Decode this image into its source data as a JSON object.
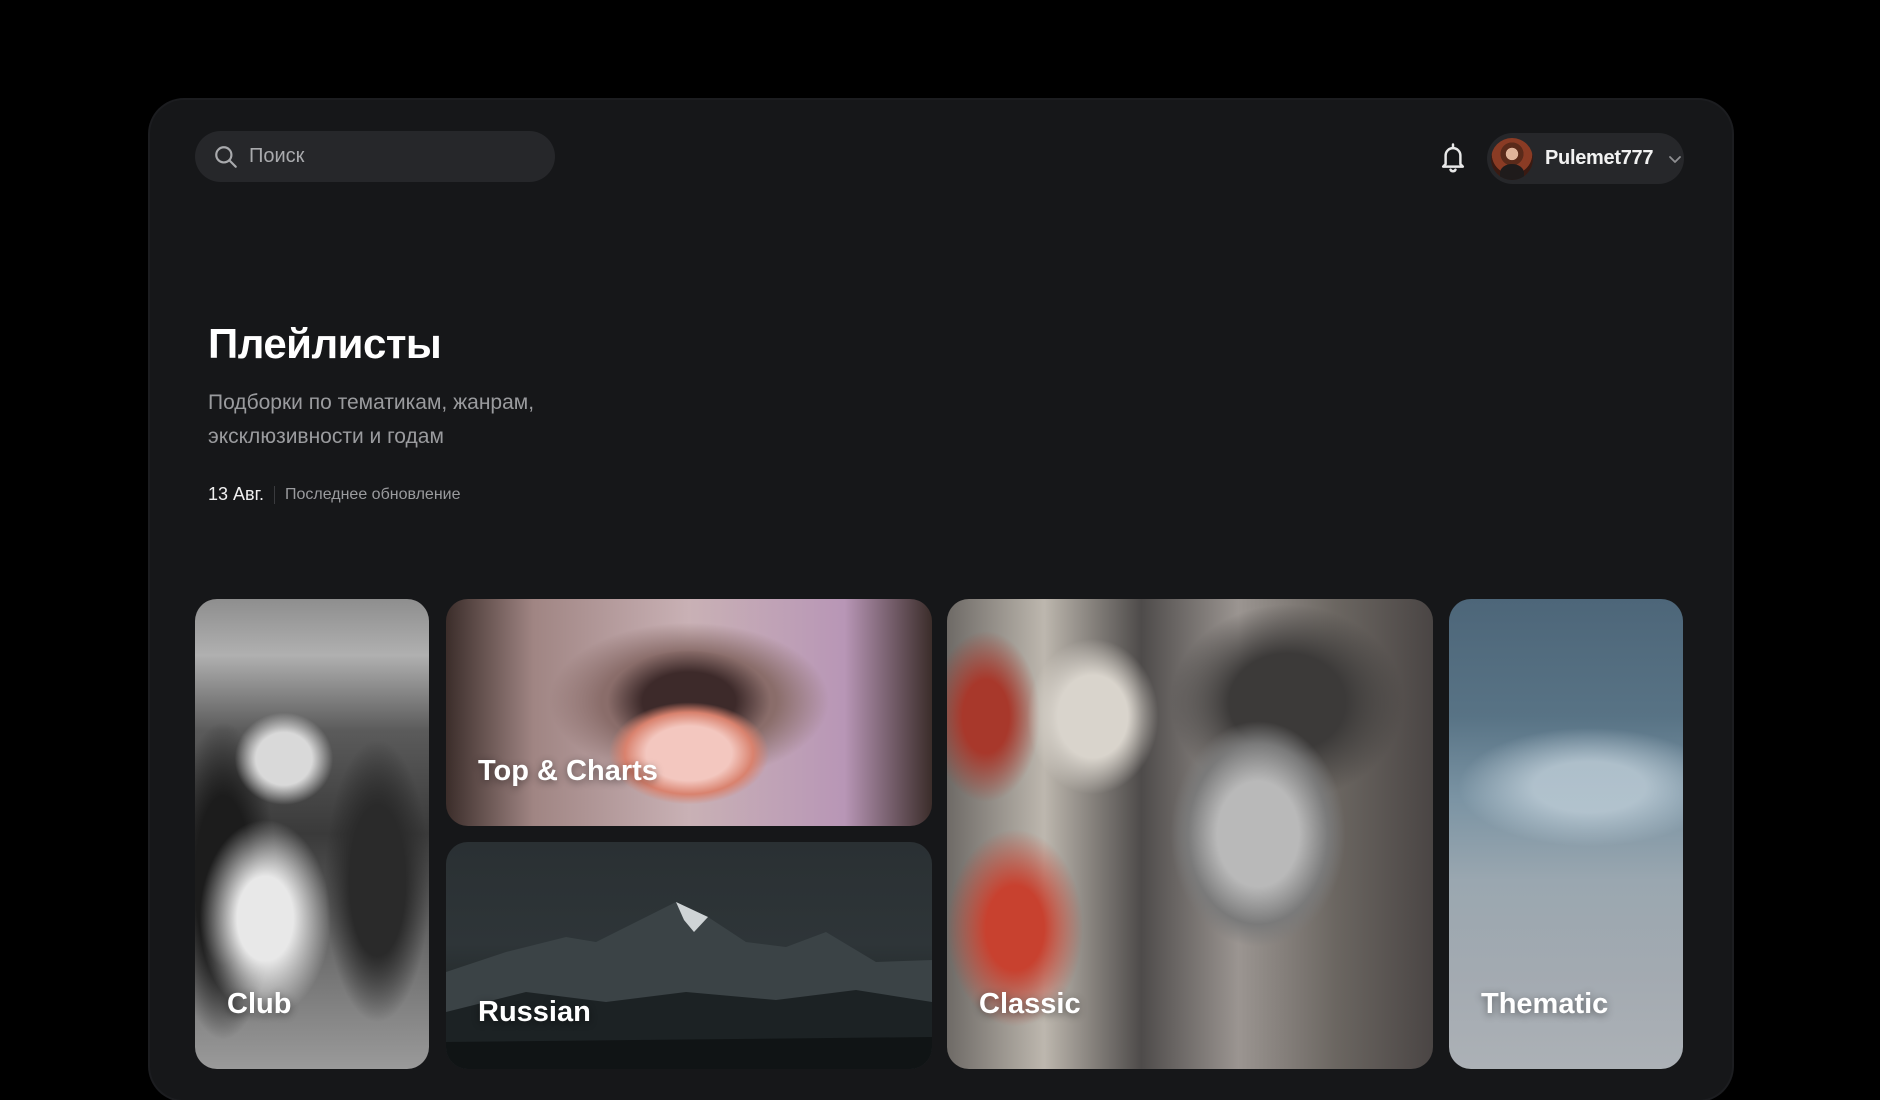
{
  "header": {
    "search": {
      "placeholder": "Поиск",
      "value": ""
    },
    "user": {
      "name": "Pulemet777"
    }
  },
  "hero": {
    "title": "Плейлисты",
    "subtitle": "Подборки по тематикам, жанрам, эксклюзивности и годам",
    "update_date": "13 Авг.",
    "update_label": "Последнее обновление"
  },
  "cards": {
    "club": "Club",
    "top_charts": "Top & Charts",
    "russian": "Russian",
    "classic": "Classic",
    "thematic": "Thematic"
  },
  "colors": {
    "page_bg": "#000000",
    "window_bg": "#161719",
    "control_bg": "#26272a",
    "text_primary": "#ffffff",
    "text_secondary": "#9a9b9e"
  },
  "icons": {
    "search": "search-icon",
    "bell": "bell-icon",
    "chevron": "chevron-down-icon"
  }
}
